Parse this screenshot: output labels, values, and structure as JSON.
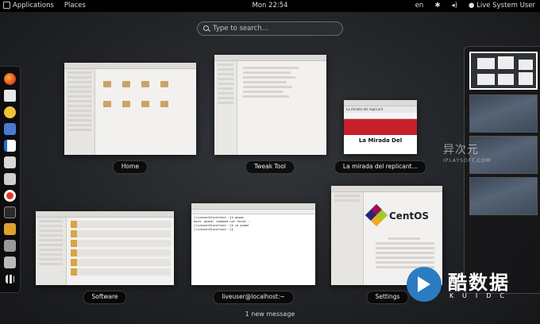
{
  "topbar": {
    "applications": "Applications",
    "places": "Places",
    "clock": "Mon 22:54",
    "lang": "en",
    "user": "Live System User",
    "icons": [
      "network-icon",
      "bluetooth-icon",
      "volume-icon",
      "battery-icon",
      "power-icon"
    ]
  },
  "search": {
    "placeholder": "Type to search…"
  },
  "windows": [
    {
      "caption": "Home"
    },
    {
      "caption": "Tweak Tool"
    },
    {
      "caption": "La mirada del replicant…"
    },
    {
      "caption": "Software"
    },
    {
      "caption": "liveuser@localhost:~"
    },
    {
      "caption": "Settings"
    }
  ],
  "browser": {
    "tab": "La mirada del replicant",
    "page_title": "La Mirada Del"
  },
  "terminal": {
    "lines": [
      "[liveuser@localhost ~]$ gnome",
      "bash: gnome: command not found...",
      "[liveuser@localhost ~]$ cd gnome",
      "[liveuser@localhost ~]$"
    ]
  },
  "settings": {
    "brand": "CentOS"
  },
  "message": "1 new message",
  "watermarks": {
    "logo_cn": "酷数据",
    "logo_en": "KUIDC",
    "side_cn": "异次元",
    "side_en": "IPLAYSOFT.COM"
  },
  "dash_apps": [
    "firefox-icon",
    "evolution-icon",
    "rhythmbox-icon",
    "shotwell-icon",
    "libreoffice-writer-icon",
    "documents-icon",
    "files-icon",
    "help-icon",
    "terminal-icon",
    "software-icon",
    "tools-icon",
    "utilities-icon",
    "show-apps-icon"
  ],
  "colors": {
    "accent": "#4a90d9",
    "browser_red": "#c81f2b",
    "centos_green": "#9ccd2a"
  }
}
